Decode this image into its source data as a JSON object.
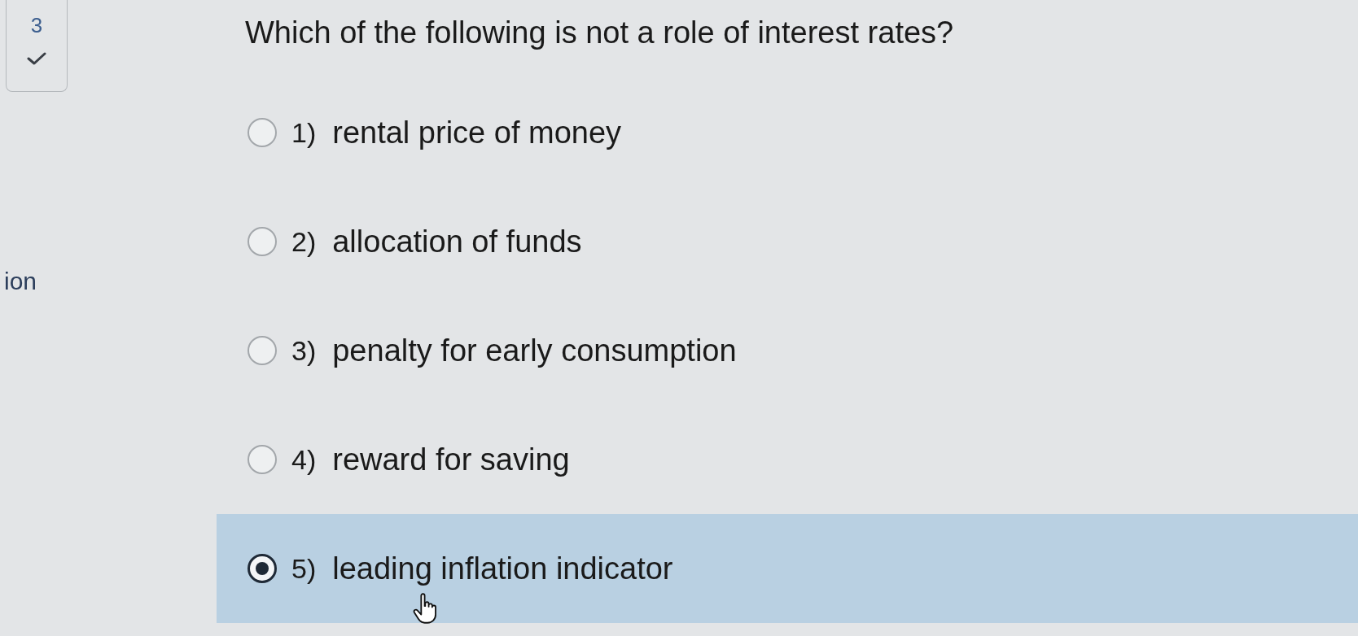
{
  "question_nav": {
    "number": "3",
    "answered": true
  },
  "side_label": "ion",
  "question": {
    "text": "Which of the following is not a role of interest rates?"
  },
  "options": [
    {
      "number": "1)",
      "text": "rental price of money",
      "selected": false
    },
    {
      "number": "2)",
      "text": "allocation of funds",
      "selected": false
    },
    {
      "number": "3)",
      "text": "penalty for early consumption",
      "selected": false
    },
    {
      "number": "4)",
      "text": "reward for saving",
      "selected": false
    },
    {
      "number": "5)",
      "text": "leading inflation indicator",
      "selected": true
    }
  ]
}
